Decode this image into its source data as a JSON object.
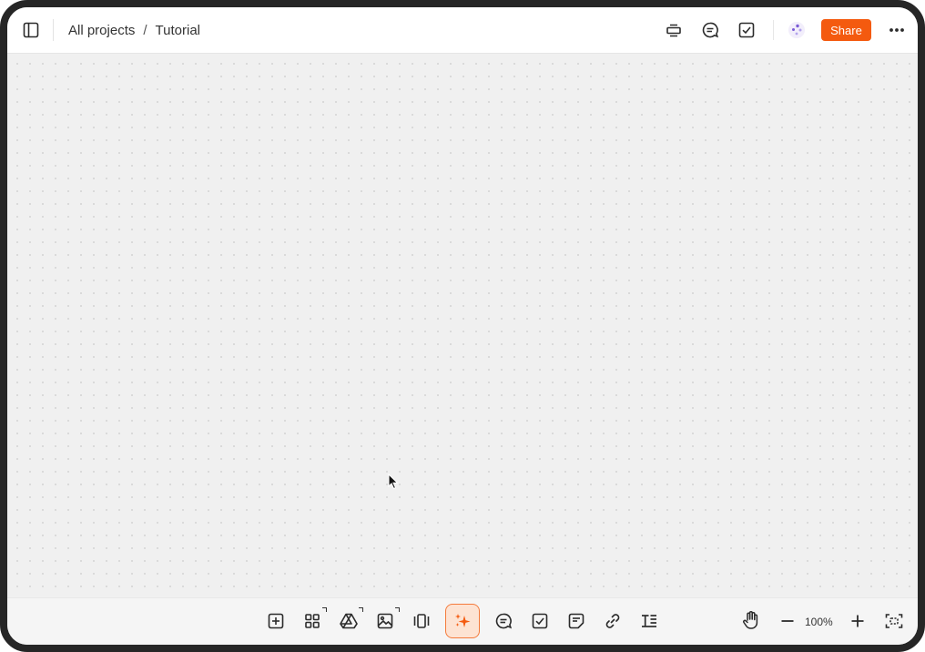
{
  "header": {
    "breadcrumb": {
      "root": "All projects",
      "separator": "/",
      "current": "Tutorial"
    },
    "share_label": "Share",
    "icons": {
      "sidebar_toggle": "sidebar-toggle-icon",
      "present": "present-icon",
      "comments": "comment-icon",
      "tasks": "checkbox-icon",
      "avatar": "collaborator-avatar-icon",
      "more": "more-horizontal-icon"
    }
  },
  "toolbar": {
    "tools": [
      "add-frame-icon",
      "apps-grid-icon",
      "google-drive-icon",
      "image-icon",
      "carousel-icon",
      "ai-sparkle-icon",
      "comment-icon",
      "checkbox-icon",
      "sticky-note-icon",
      "link-icon",
      "text-icon"
    ],
    "zoom_level": "100%",
    "right_tools": [
      "hand-icon",
      "zoom-out-icon",
      "zoom-in-icon",
      "fit-to-screen-icon"
    ]
  },
  "colors": {
    "accent": "#f45a0f",
    "ai_button_bg": "#fde3d3",
    "canvas_bg": "#f0f0f0",
    "frame": "#262626"
  }
}
